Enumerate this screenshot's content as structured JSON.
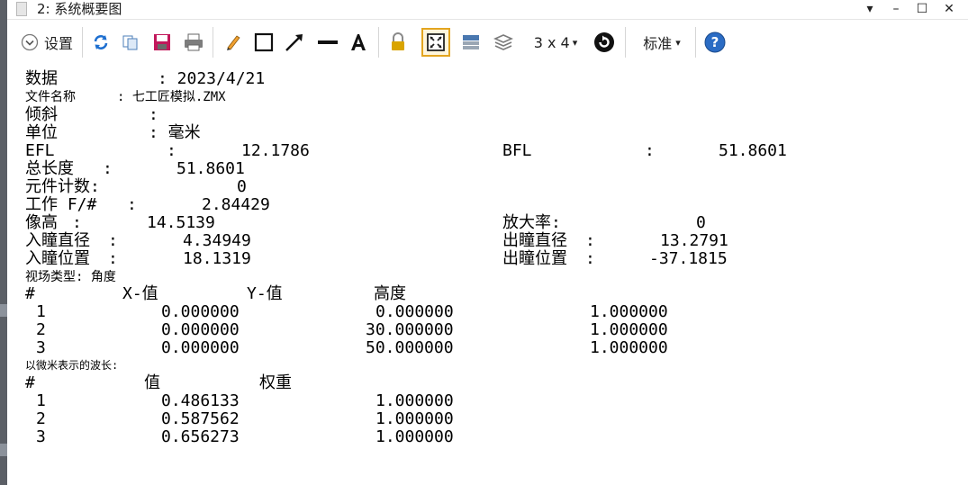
{
  "window": {
    "title": "2: 系统概要图",
    "buttons": {
      "menu": "▾",
      "minimize": "–",
      "maximize": "☐",
      "close": "✕"
    }
  },
  "toolbar": {
    "settings_label": "设置",
    "layout_label": "3 x 4",
    "style_label": "标准",
    "dropdown_arrow": "▾"
  },
  "report": {
    "date_label": "数据",
    "date_value": ": 2023/4/21",
    "file_label": "文件名称",
    "file_value": ": 七工匠模拟.ZMX",
    "tilt_label": "倾斜",
    "tilt_value": ":",
    "unit_label": "单位",
    "unit_value": ": 毫米",
    "efl_label": "EFL",
    "efl_value": "12.1786",
    "bfl_label": "BFL",
    "bfl_value": "51.8601",
    "total_length_label": "总长度",
    "total_length_value": "51.8601",
    "element_count_label": "元件计数:",
    "element_count_value": "0",
    "working_fnum_label": "工作 F/#",
    "working_fnum_value": "2.84429",
    "image_height_label": "像高",
    "image_height_value": "14.5139",
    "magnification_label": "放大率:",
    "magnification_value": "0",
    "epd_label": "入瞳直径",
    "epd_value": "4.34949",
    "exd_label": "出瞳直径",
    "exd_value": "13.2791",
    "enp_label": "入瞳位置",
    "enp_value": "18.1319",
    "exp_label": "出瞳位置",
    "exp_value": "-37.1815",
    "field_type_label": "视场类型: 角度"
  },
  "fields": {
    "headers": [
      "#",
      "X-值",
      "Y-值",
      "高度"
    ],
    "rows": [
      {
        "n": "1",
        "x": "0.000000",
        "y": "0.000000",
        "h": "1.000000"
      },
      {
        "n": "2",
        "x": "0.000000",
        "y": "30.000000",
        "h": "1.000000"
      },
      {
        "n": "3",
        "x": "0.000000",
        "y": "50.000000",
        "h": "1.000000"
      }
    ]
  },
  "wavelengths": {
    "caption": "以微米表示的波长:",
    "headers": [
      "#",
      "值",
      "权重"
    ],
    "rows": [
      {
        "n": "1",
        "v": "0.486133",
        "w": "1.000000"
      },
      {
        "n": "2",
        "v": "0.587562",
        "w": "1.000000"
      },
      {
        "n": "3",
        "v": "0.656273",
        "w": "1.000000"
      }
    ]
  }
}
